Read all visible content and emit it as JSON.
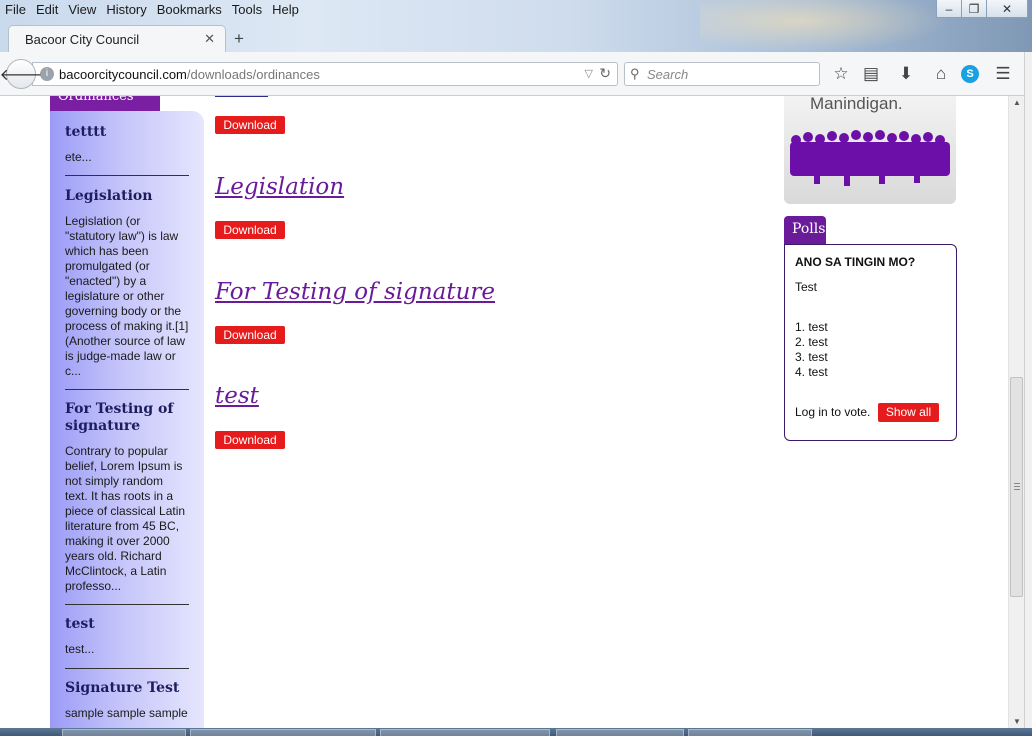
{
  "browser": {
    "menu": [
      "File",
      "Edit",
      "View",
      "History",
      "Bookmarks",
      "Tools",
      "Help"
    ],
    "tab_title": "Bacoor City Council",
    "url_domain": "bacoorcitycouncil.com",
    "url_path": "/downloads/ordinances",
    "search_placeholder": "Search",
    "icons": [
      "back-arrow-icon",
      "site-info-icon",
      "reload-icon",
      "search-icon",
      "bookmark-star-icon",
      "reading-list-icon",
      "download-icon",
      "home-icon",
      "skype-icon",
      "menu-icon"
    ]
  },
  "sidebar": {
    "heading": "Ordinances",
    "items": [
      {
        "title": "tetttt",
        "text": "ete..."
      },
      {
        "title": "Legislation",
        "text": "Legislation (or \"statutory law\") is law which has been promulgated (or \"enacted\") by a legislature or other governing body or the process of making it.[1] (Another source of law is judge-made law or c..."
      },
      {
        "title": "For Testing of signature",
        "text": "Contrary to popular belief, Lorem Ipsum is not simply random text. It has roots in a piece of classical Latin literature from 45 BC, making it over 2000 years old. Richard McClintock, a Latin professo..."
      },
      {
        "title": "test",
        "text": "test..."
      },
      {
        "title": "Signature Test",
        "text": "sample sample sample"
      }
    ]
  },
  "main": {
    "download_label": "Download",
    "entries": [
      {
        "title": "Legislation"
      },
      {
        "title": "For Testing of signature"
      },
      {
        "title": "test"
      }
    ]
  },
  "promo": {
    "text": "Manindigan."
  },
  "polls": {
    "tab": "Polls",
    "question": "ANO SA TINGIN MO?",
    "description": "Test",
    "options": [
      "1. test",
      "2. test",
      "3. test",
      "4. test"
    ],
    "login_text": "Log in to vote.",
    "show_all": "Show all"
  }
}
